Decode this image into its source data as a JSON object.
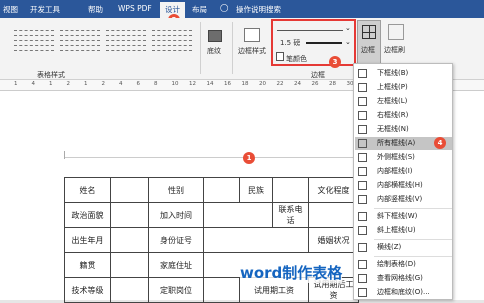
{
  "tabs": [
    "视图",
    "开发工具",
    "帮助",
    "WPS PDF",
    "设计",
    "布局",
    "操作说明搜索"
  ],
  "ribbon": {
    "table_styles_label": "表格样式",
    "shading_label": "底纹",
    "border_styles_label": "边框样式",
    "line_weight": "1.5 磅",
    "pen_color_label": "笔颜色",
    "borders_group_label": "边框",
    "borders_button": "边框",
    "border_painter": "边框刷"
  },
  "ruler_ticks": [
    "1",
    "4",
    "1",
    "2",
    "1",
    "2",
    "4",
    "6",
    "8",
    "10",
    "12",
    "14",
    "16",
    "18",
    "20",
    "22",
    "24",
    "26",
    "28",
    "30",
    "32",
    "34",
    "36",
    "38"
  ],
  "badges": {
    "b1": "1",
    "b2": "2",
    "b3": "3",
    "b4": "4"
  },
  "menu_items": [
    "下框线(B)",
    "上框线(P)",
    "左框线(L)",
    "右框线(R)",
    "无框线(N)",
    "所有框线(A)",
    "外侧框线(S)",
    "内部框线(I)",
    "内部横框线(H)",
    "内部竖框线(V)",
    "斜下框线(W)",
    "斜上框线(U)",
    "横线(Z)",
    "绘制表格(D)",
    "查看网格线(G)",
    "边框和底纹(O)..."
  ],
  "table": {
    "r1": [
      "姓名",
      "性别",
      "民族",
      "文化程度"
    ],
    "r2": [
      "政治面貌",
      "加入时间",
      "联系电话"
    ],
    "r3": [
      "出生年月",
      "身份证号",
      "婚姻状况"
    ],
    "r4": [
      "籍贯",
      "家庭住址"
    ],
    "r5": [
      "技术等级",
      "定职岗位",
      "试用期工资",
      "试用期后工资"
    ]
  },
  "watermark": "word制作表格",
  "colors": {
    "ribbon_blue": "#2b579a",
    "badge_red": "#e94d36",
    "watermark_blue": "#1565c0"
  }
}
